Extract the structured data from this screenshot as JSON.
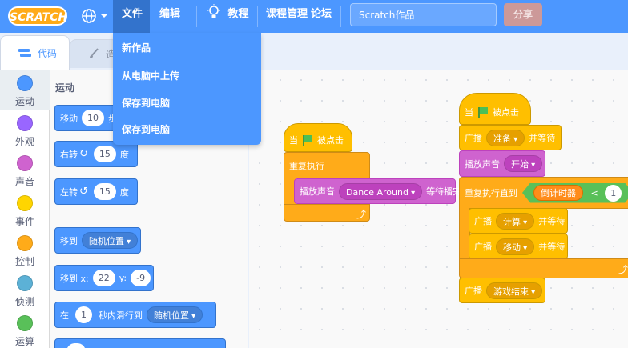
{
  "menubar": {
    "logo": "SCRATCH",
    "file": "文件",
    "edit": "编辑",
    "tutorials": "教程",
    "course": "课程管理",
    "forum": "论坛",
    "project_title": "Scratch作品",
    "share": "分享",
    "accent": "#4c97ff"
  },
  "file_menu": {
    "items": [
      "新作品",
      "从电脑中上传",
      "保存到电脑",
      "保存到电脑"
    ]
  },
  "tabs": {
    "code": "代码",
    "costumes": "造"
  },
  "categories": [
    {
      "label": "运动",
      "color": "#4c97ff"
    },
    {
      "label": "外观",
      "color": "#9966ff"
    },
    {
      "label": "声音",
      "color": "#cf63cf"
    },
    {
      "label": "事件",
      "color": "#ffd500"
    },
    {
      "label": "控制",
      "color": "#ffab19"
    },
    {
      "label": "侦测",
      "color": "#5cb1d6"
    },
    {
      "label": "运算",
      "color": "#59c059"
    }
  ],
  "palette": {
    "title": "运动",
    "move": {
      "label": "移动",
      "steps_value": "10",
      "suffix": "步"
    },
    "turn_right": {
      "label": "右转",
      "value": "15",
      "unit": "度"
    },
    "turn_left": {
      "label": "左转",
      "value": "15",
      "unit": "度"
    },
    "goto": {
      "label": "移到",
      "dropdown": "随机位置"
    },
    "goto_xy": {
      "label": "移到 x:",
      "x": "22",
      "y_label": "y:",
      "y": "-9"
    },
    "glide": {
      "pre": "在",
      "secs": "1",
      "mid": "秒内滑行到",
      "dropdown": "随机位置"
    }
  },
  "script1": {
    "hat_when": "当",
    "hat_clicked": "被点击",
    "forever": "重复执行",
    "play_until_done": "播放声音",
    "sound_name": "Dance Around",
    "play_suffix": "等待播完"
  },
  "script2": {
    "hat_when": "当",
    "hat_clicked": "被点击",
    "broadcast_wait_1": "广播",
    "msg_ready": "准备",
    "and_wait": "并等待",
    "play_sound": "播放声音",
    "sound_start": "开始",
    "repeat_until": "重复执行直到",
    "timer_var": "倒计时器",
    "less_than": "<",
    "compare_value": "1",
    "broadcast_count": "广播",
    "msg_count": "计算",
    "and_wait_2": "并等待",
    "broadcast_move": "广播",
    "msg_move": "移动",
    "and_wait_3": "并等待",
    "broadcast_end": "广播",
    "msg_end": "游戏结束"
  }
}
